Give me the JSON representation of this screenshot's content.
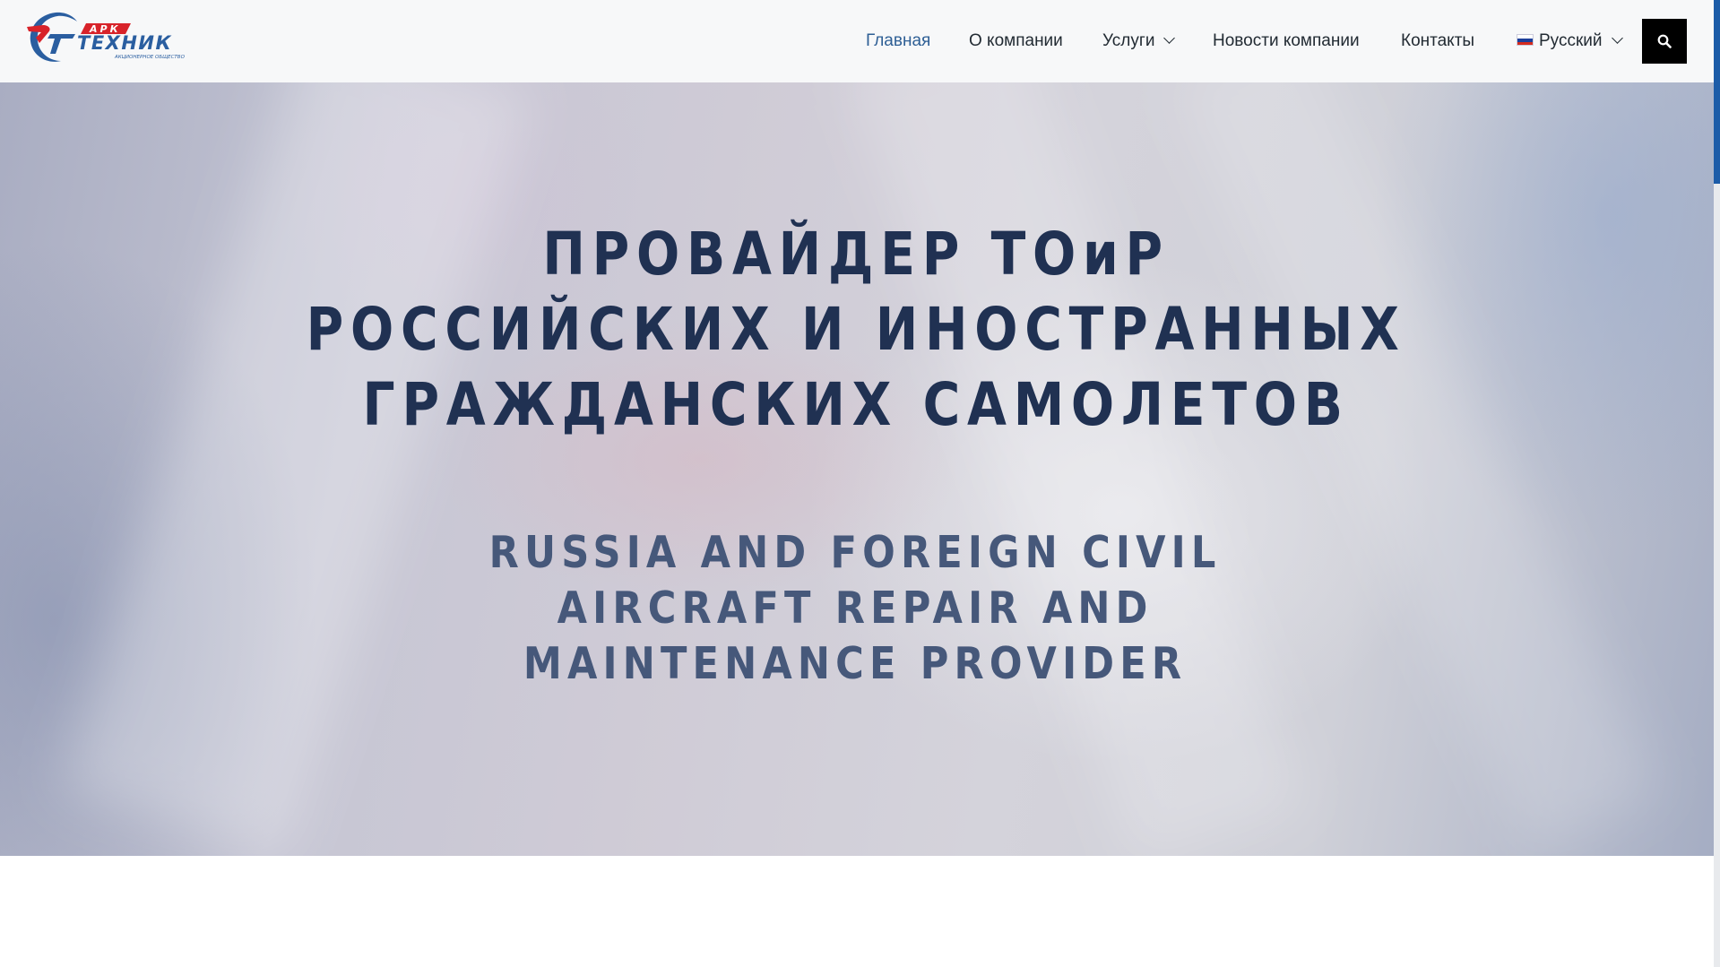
{
  "header": {
    "logo": {
      "brand_top": "АРК",
      "brand_main": "ТЕХНИК",
      "tagline": "АКЦИОНЕРНОЕ ОБЩЕСТВО",
      "colors": {
        "red": "#d8232a",
        "blue": "#2a5ea0"
      }
    },
    "nav": {
      "items": [
        {
          "label": "Главная",
          "active": true
        },
        {
          "label": "О компании"
        },
        {
          "label": "Услуги",
          "has_dropdown": true
        },
        {
          "label": "Новости компании"
        },
        {
          "label": "Контакты"
        }
      ],
      "language": {
        "label": "Русский",
        "flag": "ru-flag-icon",
        "has_dropdown": true
      },
      "search_icon": "search-icon"
    }
  },
  "hero": {
    "title_lines": [
      "ПРОВАЙДЕР ТОиР",
      "РОССИЙСКИХ И ИНОСТРАННЫХ",
      "ГРАЖДАНСКИХ САМОЛЕТОВ"
    ],
    "subtitle_lines": [
      "RUSSIA AND FOREIGN CIVIL",
      "AIRCRAFT REPAIR AND",
      "MAINTENANCE PROVIDER"
    ]
  },
  "colors": {
    "nav_active": "#2e5f95",
    "nav_text": "#222b33",
    "title": "#203152",
    "subtitle": "#46587a",
    "search_button": "#000000",
    "scrollbar_thumb": "#1c5ca8"
  }
}
